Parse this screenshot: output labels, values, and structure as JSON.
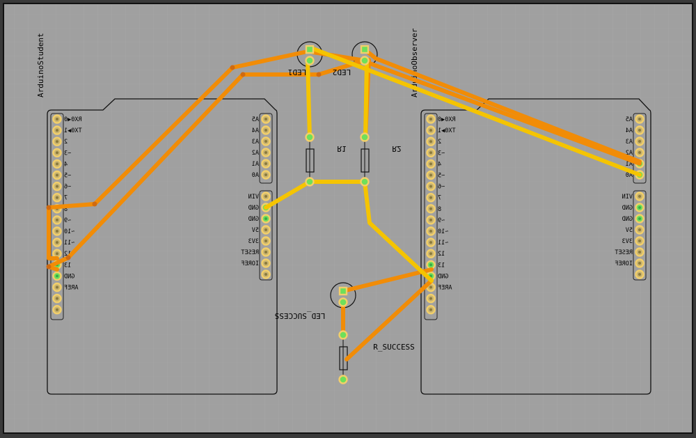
{
  "colors": {
    "board_bg": "#a0a0a0",
    "grid": "#aaaaaa",
    "outline": "#111111",
    "trace_orange": "#f18c07",
    "trace_yellow": "#f5c400",
    "pad_ring": "#f2cf6a",
    "pad_green": "#6ee05a"
  },
  "boards": {
    "student": {
      "name": "ArduinoStudent",
      "left_pins": [
        "RX0◀0",
        "TX0▶1",
        "2",
        "~3",
        "4",
        "~5",
        "~6",
        "7",
        "8",
        "~9",
        "~10",
        "~11",
        "12",
        "13",
        "GND",
        "AREF",
        "",
        ""
      ],
      "right_pins_top": [
        "A5",
        "A4",
        "A3",
        "A2",
        "A1",
        "A0"
      ],
      "right_pins_bottom": [
        "VIN",
        "GND",
        "GND",
        "5V",
        "3V3",
        "RESET",
        "IOREF",
        ""
      ]
    },
    "observer": {
      "name": "ArduinoObserver",
      "left_pins": [
        "RX0◀0",
        "TX0▶1",
        "2",
        "~3",
        "4",
        "~5",
        "~6",
        "7",
        "8",
        "~9",
        "~10",
        "~11",
        "12",
        "13",
        "GND",
        "AREF",
        "",
        ""
      ],
      "right_pins_top": [
        "A5",
        "A4",
        "A3",
        "A2",
        "A1",
        "A0"
      ],
      "right_pins_bottom": [
        "VIN",
        "GND",
        "GND",
        "5V",
        "3V3",
        "RESET",
        "IOREF",
        ""
      ]
    }
  },
  "parts": {
    "led1": "LED1",
    "led2": "LED2",
    "r1": "R1",
    "r2": "R2",
    "led_success": "LED_SUCCESS",
    "r_success": "R_SUCCESS"
  }
}
